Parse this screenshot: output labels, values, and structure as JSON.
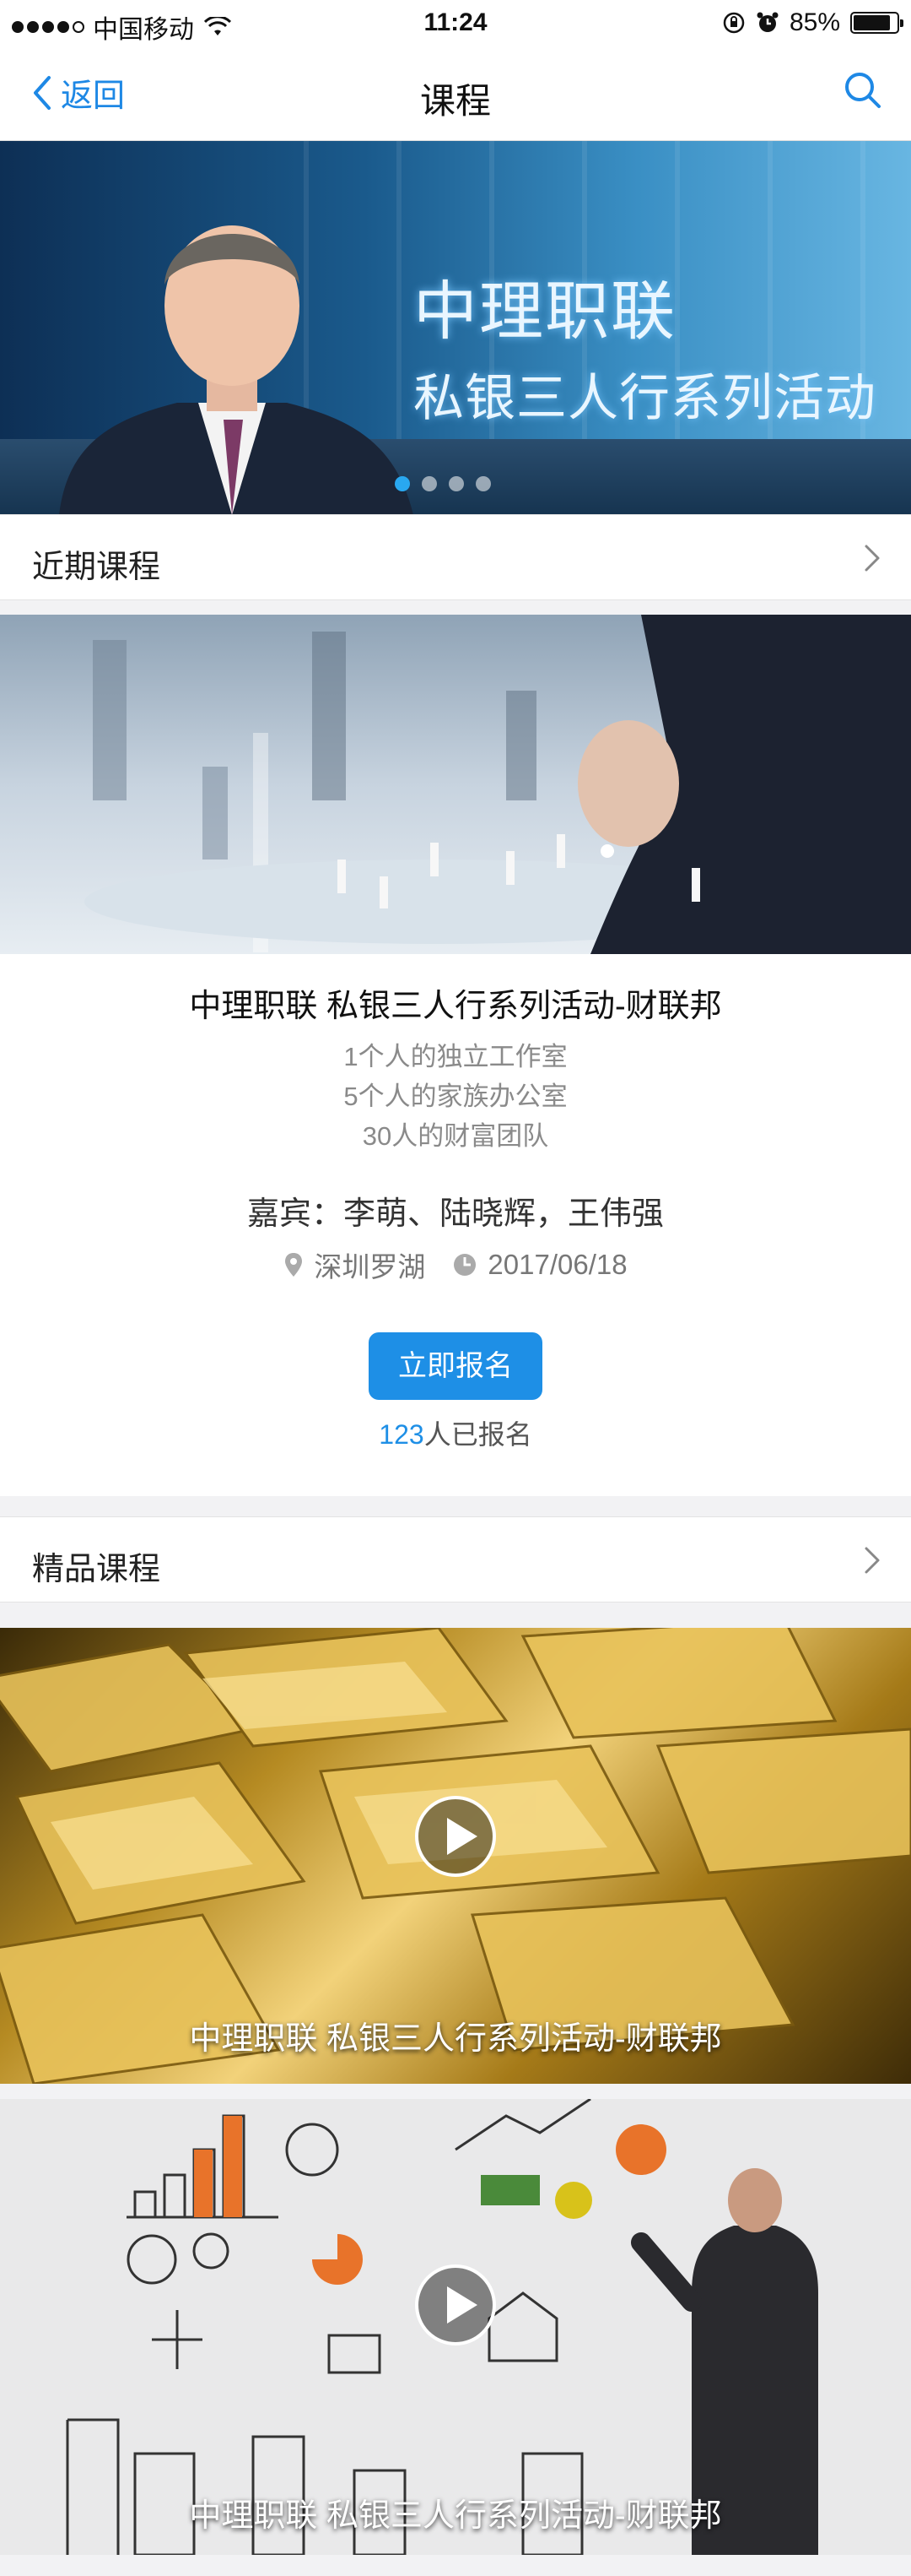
{
  "status_bar": {
    "carrier": "中国移动",
    "time": "11:24",
    "battery_percent": "85%",
    "battery_level": 0.85
  },
  "nav": {
    "back_label": "返回",
    "title": "课程",
    "back_icon": "chevron-left-icon",
    "search_icon": "search-icon"
  },
  "banner": {
    "line1": "中理职联",
    "line2": "私银三人行系列活动",
    "slide_count": 4,
    "active_slide": 1
  },
  "recent_section": {
    "title": "近期课程"
  },
  "course": {
    "title": "中理职联 私银三人行系列活动-财联邦",
    "desc_lines": [
      "1个人的独立工作室",
      "5个人的家族办公室",
      "30人的财富团队"
    ],
    "guests": "嘉宾：李萌、陆晓辉，王伟强",
    "location": "深圳罗湖",
    "date": "2017/06/18",
    "signup_button": "立即报名",
    "signup_count": "123",
    "signup_suffix": "人已报名"
  },
  "premium_section": {
    "title": "精品课程"
  },
  "videos": [
    {
      "caption": "中理职联 私银三人行系列活动-财联邦"
    },
    {
      "caption": "中理职联 私银三人行系列活动-财联邦"
    }
  ],
  "colors": {
    "accent": "#1e8fe6",
    "background": "#f2f2f4"
  }
}
